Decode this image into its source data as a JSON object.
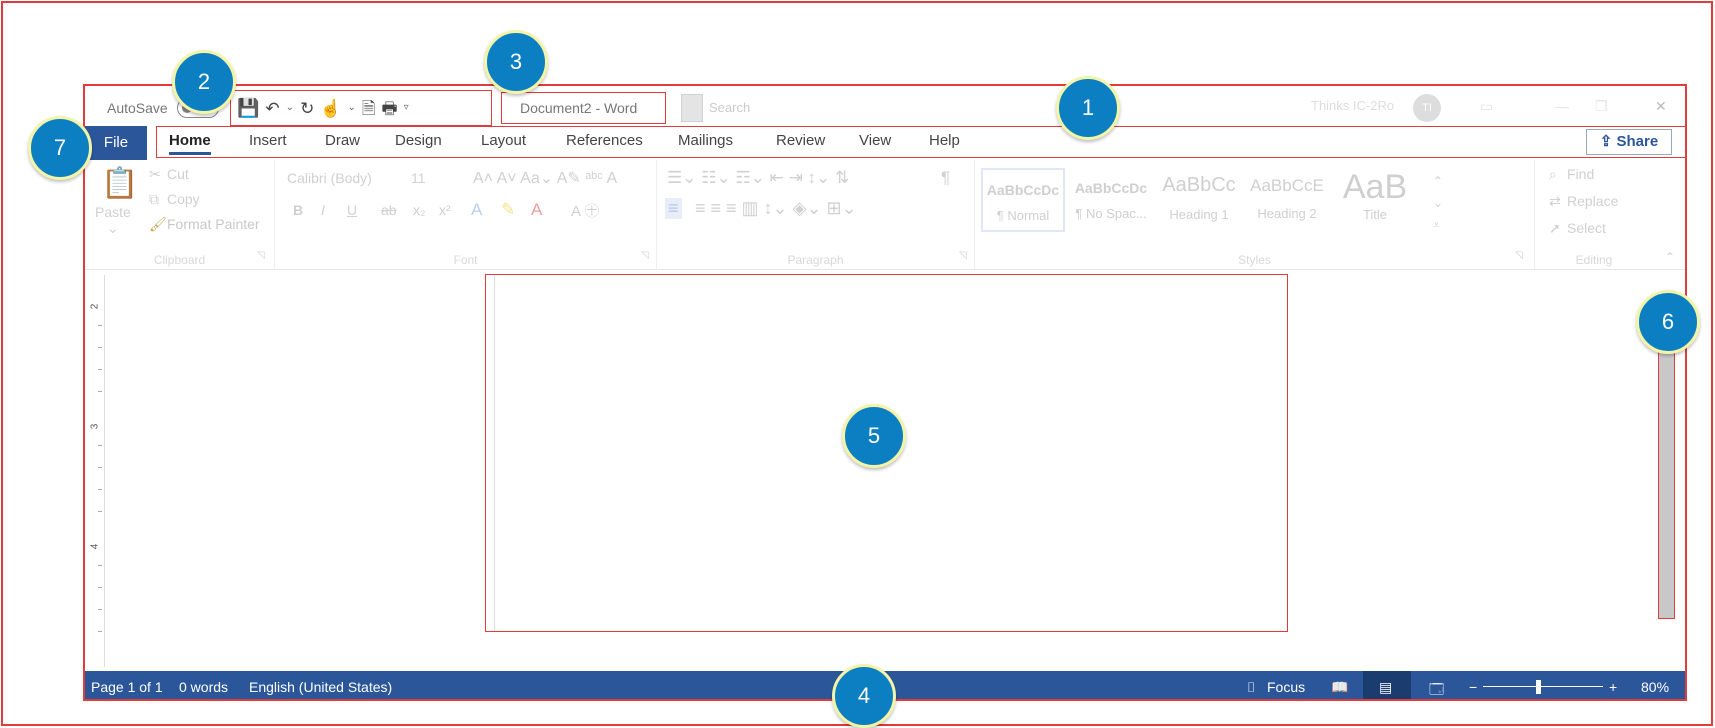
{
  "titlebar": {
    "autosave_label": "AutoSave",
    "doc_title": "Document2  -  Word",
    "search_placeholder": "Search",
    "user_name": "Thinks IC-2Ro",
    "user_initials": "TI"
  },
  "quick_access": {
    "save_icon": "💾",
    "undo_icon": "↶",
    "redo_icon": "↻",
    "touch_icon": "☝",
    "print_preview_icon": "🗎",
    "print_icon": "🖶",
    "customize_icon": "▿"
  },
  "tabs": {
    "file": "File",
    "items": [
      "Home",
      "Insert",
      "Draw",
      "Design",
      "Layout",
      "References",
      "Mailings",
      "Review",
      "View",
      "Help"
    ],
    "share": "Share"
  },
  "ribbon": {
    "clipboard": {
      "paste": "Paste",
      "cut": "Cut",
      "copy": "Copy",
      "format_painter": "Format Painter",
      "label": "Clipboard"
    },
    "font": {
      "name": "Calibri (Body)",
      "size": "11",
      "label": "Font",
      "bold": "B",
      "italic": "I",
      "underline": "U",
      "strike": "ab",
      "sub": "x₂",
      "sup": "x²"
    },
    "paragraph": {
      "label": "Paragraph",
      "pilcrow": "¶"
    },
    "styles": {
      "label": "Styles",
      "items": [
        {
          "preview": "AaBbCcDc",
          "name": "¶ Normal"
        },
        {
          "preview": "AaBbCcDc",
          "name": "¶ No Spac..."
        },
        {
          "preview": "AaBbCc",
          "name": "Heading 1"
        },
        {
          "preview": "AaBbCcE",
          "name": "Heading 2"
        },
        {
          "preview": "AaB",
          "name": "Title"
        }
      ]
    },
    "editing": {
      "find": "Find",
      "replace": "Replace",
      "select": "Select",
      "label": "Editing"
    }
  },
  "ruler": {
    "numbers": [
      "2",
      "3",
      "4"
    ]
  },
  "statusbar": {
    "page": "Page 1 of 1",
    "words": "0 words",
    "language": "English (United States)",
    "focus": "Focus",
    "zoom_minus": "−",
    "zoom_plus": "+",
    "zoom": "80%"
  },
  "callouts": [
    "1",
    "2",
    "3",
    "4",
    "5",
    "6",
    "7"
  ],
  "colors": {
    "accent": "#2b579a",
    "highlight": "#e23b3b",
    "callout": "#0b7fc2"
  }
}
